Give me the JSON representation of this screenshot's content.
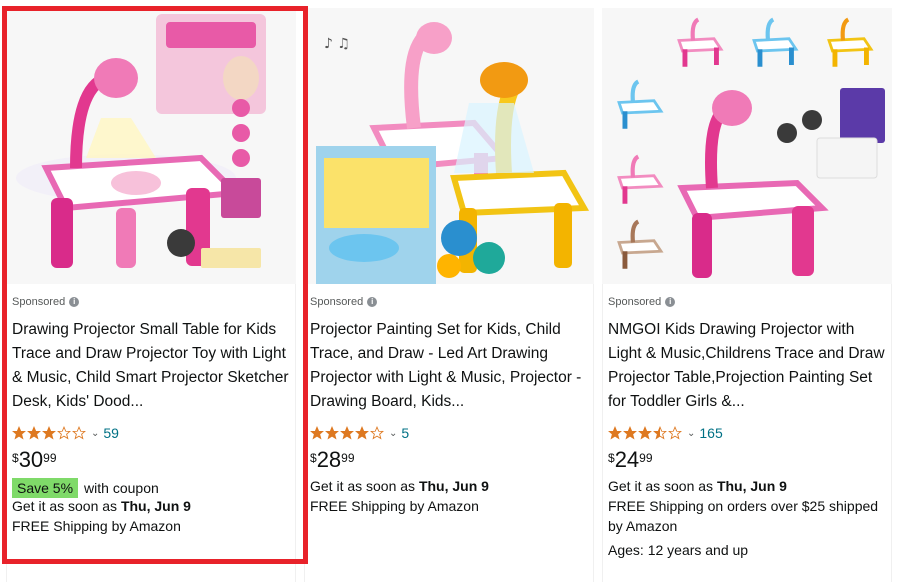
{
  "products": [
    {
      "sponsored": "Sponsored",
      "title": "Drawing Projector Small Table for Kids Trace and Draw Projector Toy with Light & Music, Child Smart Projector Sketcher Desk, Kids' Dood...",
      "rating": 3,
      "rating_count": "59",
      "price_symbol": "$",
      "price_whole": "30",
      "price_fraction": "99",
      "coupon_badge": "Save 5%",
      "coupon_text": "with coupon",
      "delivery_prefix": "Get it as soon as",
      "delivery_date": "Thu, Jun 9",
      "shipping": "FREE Shipping by Amazon",
      "shipping_2": "",
      "ages": ""
    },
    {
      "sponsored": "Sponsored",
      "title": "Projector Painting Set for Kids, Child Trace, and Draw - Led Art Drawing Projector with Light & Music, Projector - Drawing Board, Kids...",
      "rating": 4,
      "rating_count": "5",
      "price_symbol": "$",
      "price_whole": "28",
      "price_fraction": "99",
      "delivery_prefix": "Get it as soon as",
      "delivery_date": "Thu, Jun 9",
      "shipping": "FREE Shipping by Amazon"
    },
    {
      "sponsored": "Sponsored",
      "title": "NMGOI Kids Drawing Projector with Light & Music,Childrens Trace and Draw Projector Table,Projection Painting Set for Toddler Girls &...",
      "rating": 3.5,
      "rating_count": "165",
      "price_symbol": "$",
      "price_whole": "24",
      "price_fraction": "99",
      "delivery_prefix": "Get it as soon as",
      "delivery_date": "Thu, Jun 9",
      "shipping": "FREE Shipping on orders over $25 shipped",
      "shipping_2": "by Amazon",
      "ages": "Ages: 12 years and up"
    }
  ],
  "colors": {
    "highlight": "#e8222a",
    "star": "#de7921",
    "link": "#007185",
    "coupon_bg": "#7fda69"
  }
}
